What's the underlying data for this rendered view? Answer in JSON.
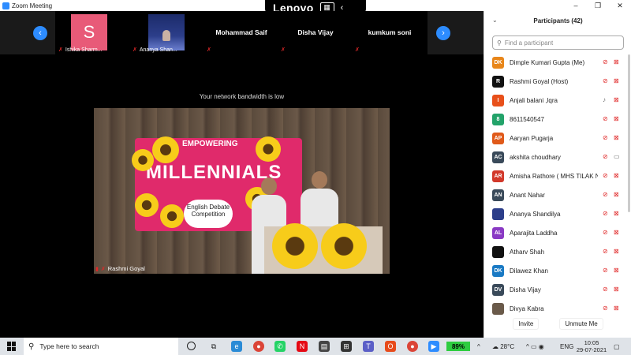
{
  "window": {
    "title": "Zoom Meeting",
    "controls": [
      "–",
      "❐",
      "✕"
    ]
  },
  "overlay": {
    "brand": "Lenovo"
  },
  "strip": {
    "tiles": [
      {
        "name": "Ishika Sharm...",
        "avatar_letter": "S"
      },
      {
        "name": "Ananya Shan..."
      },
      {
        "name": "Mohammad Saif"
      },
      {
        "name": "Disha Vijay"
      },
      {
        "name": "kumkum soni"
      }
    ]
  },
  "main": {
    "bandwidth_msg": "Your network bandwidth is low",
    "speaker": "Rashmi Goyal",
    "banner": {
      "top": "EMPOWERING",
      "big": "MILLENNIALS",
      "sub": "English Debate Competition"
    }
  },
  "participants": {
    "title": "Participants (42)",
    "search_placeholder": "Find a participant",
    "list": [
      {
        "initials": "DK",
        "name": "Dimple Kumari Gupta (Me)",
        "color": "#e8861a",
        "mic_muted": true,
        "cam_off": true
      },
      {
        "initials": "R",
        "name": "Rashmi Goyal (Host)",
        "color": "#111111",
        "mic_muted": true,
        "cam_off": true
      },
      {
        "initials": "I",
        "name": "Anjali balani ,lqra",
        "color": "#e8501a",
        "mic_muted": false,
        "cam_off": true
      },
      {
        "initials": "8",
        "name": "8611540547",
        "color": "#23a36a",
        "mic_muted": true,
        "cam_off": true
      },
      {
        "initials": "AP",
        "name": "Aaryan Pugarja",
        "color": "#e05a1a",
        "mic_muted": true,
        "cam_off": true
      },
      {
        "initials": "AC",
        "name": "akshita choudhary",
        "color": "#3a4a5a",
        "mic_muted": true,
        "cam_off": false
      },
      {
        "initials": "AR",
        "name": "Amisha Rathore ( MHS TILAK N...",
        "color": "#d2392b",
        "mic_muted": true,
        "cam_off": true
      },
      {
        "initials": "AN",
        "name": "Anant Nahar",
        "color": "#3a4a5a",
        "mic_muted": true,
        "cam_off": true
      },
      {
        "initials": "",
        "name": "Ananya Shandilya",
        "color": "#2c3e8a",
        "mic_muted": true,
        "cam_off": true
      },
      {
        "initials": "AL",
        "name": "Aparajita Laddha",
        "color": "#8a3ac4",
        "mic_muted": true,
        "cam_off": true
      },
      {
        "initials": "",
        "name": "Atharv Shah",
        "color": "#111111",
        "mic_muted": true,
        "cam_off": true
      },
      {
        "initials": "DK",
        "name": "Dilawez Khan",
        "color": "#1a7ac4",
        "mic_muted": true,
        "cam_off": true
      },
      {
        "initials": "DV",
        "name": "Disha Vijay",
        "color": "#3a4a5a",
        "mic_muted": true,
        "cam_off": true
      },
      {
        "initials": "",
        "name": "Divya Kabra",
        "color": "#6a5a4a",
        "mic_muted": true,
        "cam_off": true
      }
    ],
    "invite_label": "Invite",
    "unmute_label": "Unmute Me"
  },
  "taskbar": {
    "search_placeholder": "Type here to search",
    "battery": "89%",
    "temperature": "28°C",
    "lang": "ENG",
    "time": "10:05",
    "date": "29-07-2021"
  },
  "colors": {
    "accent": "#2d8cff",
    "muted_red": "#e02828",
    "banner_pink": "#e02a6b"
  }
}
